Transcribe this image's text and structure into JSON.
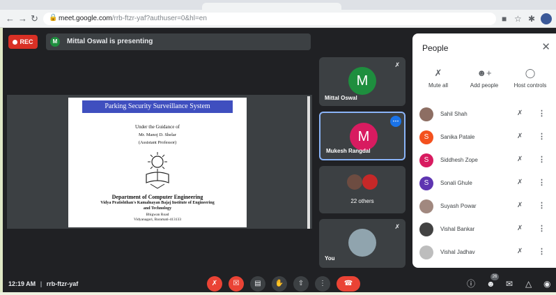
{
  "browser": {
    "url_host": "meet.google.com",
    "url_path": "/rrb-ftzr-yaf?authuser=0&hl=en",
    "icons": [
      "back-icon",
      "forward-icon",
      "reload-icon",
      "lock-icon",
      "camera-icon",
      "star-icon",
      "extensions-icon",
      "profile-icon"
    ]
  },
  "topbar": {
    "rec_label": "REC",
    "presenter_initial": "M",
    "presenting_text": "Mittal Oswal is presenting"
  },
  "slide": {
    "title": "Parking Security Surveillance System",
    "guidance": "Under the Guidance of",
    "guide_name": "Mr. Manoj D. Shelar",
    "guide_role": "(Assistant Professor)",
    "department": "Department of Computer Engineering",
    "institute_line1": "Vidya Pratishthan's Kamalnayan Bajaj Institute of Engineering",
    "institute_line2": "and Technology",
    "address_line1": "Bhigwan Road",
    "address_line2": "Vidyanagari, Baramati-413133"
  },
  "tiles": [
    {
      "name": "Mittal Oswal",
      "initial": "M",
      "color": "#1e8e3e"
    },
    {
      "name": "Mukesh Rangdal",
      "initial": "M",
      "color": "#d81b60"
    },
    {
      "name": "22 others"
    },
    {
      "name": "You"
    }
  ],
  "panel": {
    "title": "People",
    "actions": [
      {
        "label": "Mute all",
        "icon": "mic-off-icon"
      },
      {
        "label": "Add people",
        "icon": "add-person-icon"
      },
      {
        "label": "Host controls",
        "icon": "toggle-icon"
      }
    ],
    "people": [
      {
        "name": "Sahil Shah",
        "initial": "",
        "color": "#8d6e63"
      },
      {
        "name": "Sanika Patale",
        "initial": "S",
        "color": "#f4511e"
      },
      {
        "name": "Siddhesh Zope",
        "initial": "S",
        "color": "#d81b60"
      },
      {
        "name": "Sonali Ghule",
        "initial": "S",
        "color": "#5e35b1"
      },
      {
        "name": "Suyash Powar",
        "initial": "",
        "color": "#a1887f"
      },
      {
        "name": "Vishal Bankar",
        "initial": "",
        "color": "#424242"
      },
      {
        "name": "Vishal Jadhav",
        "initial": "",
        "color": "#bdbdbd"
      }
    ]
  },
  "bottombar": {
    "time": "12:19 AM",
    "separator": "|",
    "meeting_code": "rrb-ftzr-yaf",
    "participant_count": "26"
  }
}
